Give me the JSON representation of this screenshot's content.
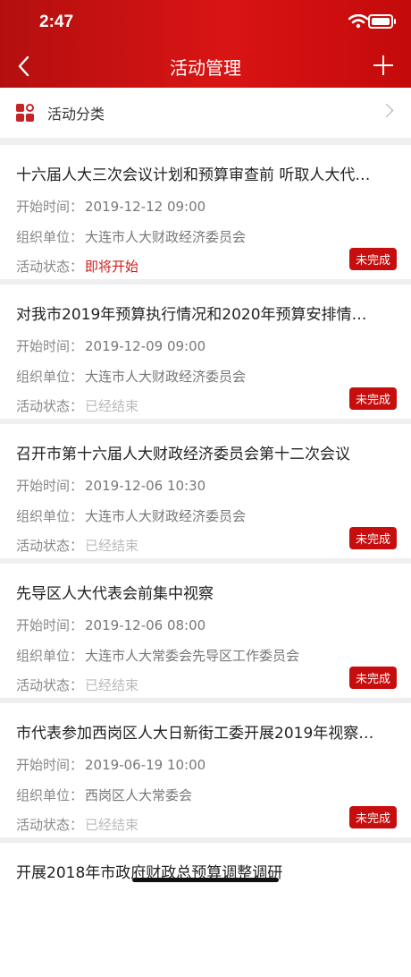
{
  "status": {
    "time": "2:47"
  },
  "nav": {
    "title": "活动管理"
  },
  "category": {
    "label": "活动分类"
  },
  "labels": {
    "start": "开始时间：",
    "org": "组织单位：",
    "state": "活动状态："
  },
  "activities": [
    {
      "title": "十六届人大三次会议计划和预算审查前 听取人大代…",
      "start": "2019-12-12 09:00",
      "org": "大连市人大财政经济委员会",
      "state": "即将开始",
      "badge": "未完成"
    },
    {
      "title": "对我市2019年预算执行情况和2020年预算安排情…",
      "start": "2019-12-09 09:00",
      "org": "大连市人大财政经济委员会",
      "state": "已经结束",
      "badge": "未完成"
    },
    {
      "title": "召开市第十六届人大财政经济委员会第十二次会议",
      "start": "2019-12-06 10:30",
      "org": "大连市人大财政经济委员会",
      "state": "已经结束",
      "badge": "未完成"
    },
    {
      "title": "先导区人大代表会前集中视察",
      "start": "2019-12-06 08:00",
      "org": "大连市人大常委会先导区工作委员会",
      "state": "已经结束",
      "badge": "未完成"
    },
    {
      "title": "市代表参加西岗区人大日新街工委开展2019年视察…",
      "start": "2019-06-19 10:00",
      "org": "西岗区人大常委会",
      "state": "已经结束",
      "badge": "未完成"
    },
    {
      "title": "开展2018年市政府财政总预算调整调研"
    }
  ],
  "colors": {
    "accent": "#d41a1a",
    "badge": "#c70e0e"
  }
}
